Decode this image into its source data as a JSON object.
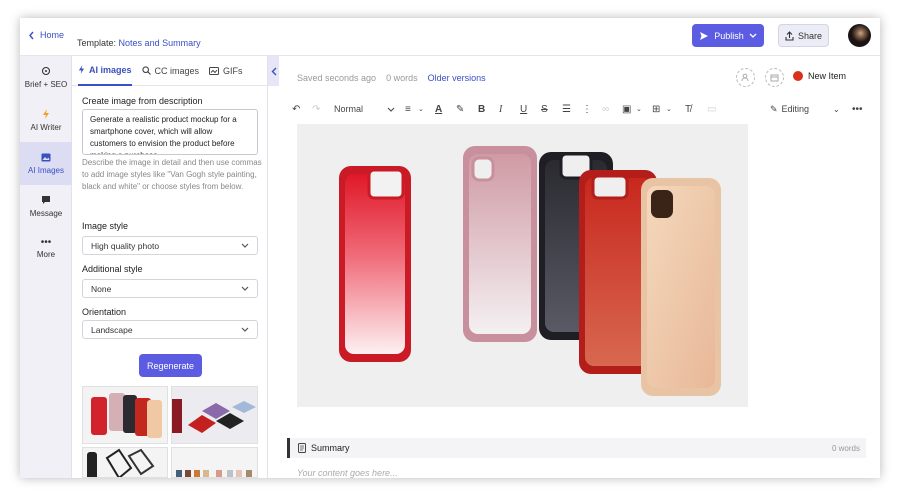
{
  "header": {
    "home_label": "Home",
    "template_prefix": "Template:",
    "template_name": "Notes and Summary",
    "publish_label": "Publish",
    "share_label": "Share"
  },
  "nav": {
    "items": [
      {
        "label": "Brief + SEO",
        "icon": "target-icon"
      },
      {
        "label": "AI Writer",
        "icon": "bolt-icon"
      },
      {
        "label": "AI Images",
        "icon": "image-icon"
      },
      {
        "label": "Message",
        "icon": "chat-icon"
      },
      {
        "label": "More",
        "icon": "more-icon"
      }
    ]
  },
  "panel": {
    "tabs": [
      {
        "label": "AI images"
      },
      {
        "label": "CC images"
      },
      {
        "label": "GIFs"
      }
    ],
    "create_title": "Create image from description",
    "description": "Generate a realistic product mockup for a smartphone cover, which will allow customers to envision the product before making a purchase.",
    "hint": "Describe the image in detail and then use commas to add image styles like \"Van Gogh style painting, black and white\" or choose styles from below.",
    "image_style_label": "Image style",
    "image_style_value": "High quality photo",
    "additional_style_label": "Additional style",
    "additional_style_value": "None",
    "orientation_label": "Orientation",
    "orientation_value": "Landscape",
    "regenerate_label": "Regenerate"
  },
  "editor": {
    "saved_text": "Saved seconds ago",
    "word_count": "0 words",
    "older_versions": "Older versions",
    "new_item_label": "New Item",
    "new_item_color": "#d8321e",
    "format_label": "Normal",
    "editing_label": "Editing",
    "summary_label": "Summary",
    "summary_words": "0 words",
    "placeholder": "Your content goes here..."
  },
  "colors": {
    "accent": "#5b5ce2",
    "link": "#3a4fc2"
  }
}
